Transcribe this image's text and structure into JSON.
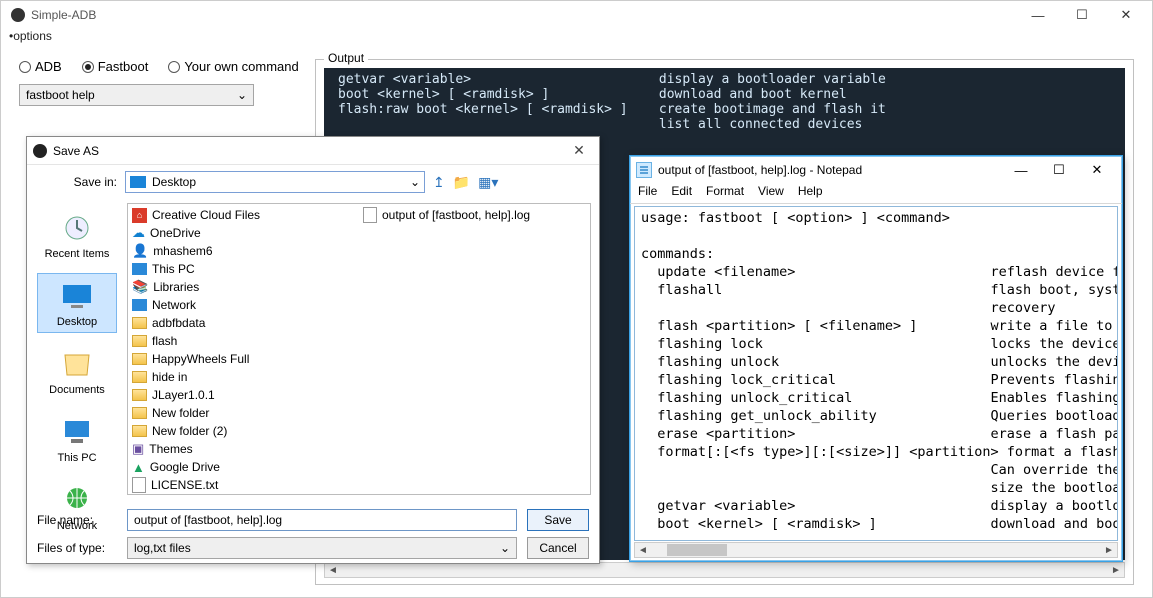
{
  "main": {
    "title": "Simple-ADB",
    "menu": "•options",
    "radios": {
      "adb": "ADB",
      "fastboot": "Fastboot",
      "own": "Your own command",
      "selected": "Fastboot"
    },
    "combo": "fastboot help",
    "output_legend": "Output",
    "terminal_lines": [
      "getvar <variable>                        display a bootloader variable",
      "boot <kernel> [ <ramdisk> ]              download and boot kernel",
      "flash:raw boot <kernel> [ <ramdisk> ]    create bootimage and flash it",
      "                                         list all connected devices"
    ]
  },
  "saveas": {
    "title": "Save AS",
    "savein_label": "Save in:",
    "location": "Desktop",
    "places": [
      "Recent Items",
      "Desktop",
      "Documents",
      "This PC",
      "Network"
    ],
    "selected_place": "Desktop",
    "col1": [
      "Creative Cloud Files",
      "OneDrive",
      "mhashem6",
      "This PC",
      "Libraries",
      "Network",
      "adbfbdata",
      "flash",
      "HappyWheels Full",
      "hide in",
      "JLayer1.0.1",
      "New folder",
      "New folder (2)",
      "Themes",
      "Google Drive",
      "LICENSE.txt"
    ],
    "col2_file": "output of [fastboot, help].log",
    "filename_label": "File name:",
    "filename_value": "output of [fastboot, help].log",
    "filetype_label": "Files of type:",
    "filetype_value": "log,txt files",
    "save_btn": "Save",
    "cancel_btn": "Cancel"
  },
  "notepad": {
    "title": "output of [fastboot, help].log - Notepad",
    "menu": [
      "File",
      "Edit",
      "Format",
      "View",
      "Help"
    ],
    "body": "usage: fastboot [ <option> ] <command>\n\ncommands:\n  update <filename>                        reflash device f\n  flashall                                 flash boot, syst\n                                           recovery\n  flash <partition> [ <filename> ]         write a file to \n  flashing lock                            locks the device\n  flashing unlock                          unlocks the devi\n  flashing lock_critical                   Prevents flashin\n  flashing unlock_critical                 Enables flashing\n  flashing get_unlock_ability              Queries bootload\n  erase <partition>                        erase a flash pa\n  format[:[<fs type>][:[<size>]] <partition> format a flash\n                                           Can override the\n                                           size the bootloa\n  getvar <variable>                        display a bootlo\n  boot <kernel> [ <ramdisk> ]              download and boo"
  }
}
